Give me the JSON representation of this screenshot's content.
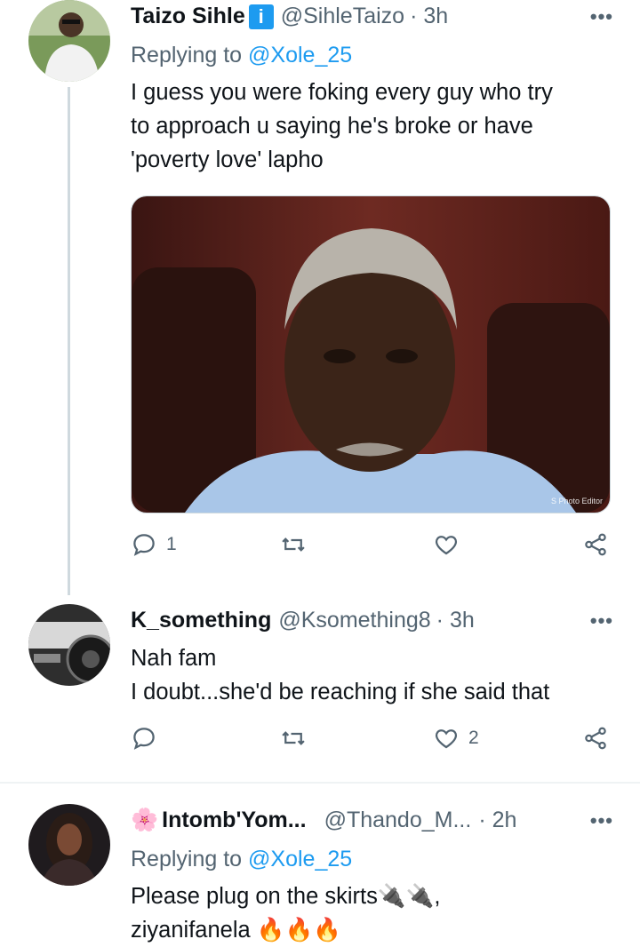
{
  "tweets": [
    {
      "name": "Taizo Sihle",
      "verified_badge": "i",
      "handle": "@SihleTaizo",
      "time": "· 3h",
      "replying_label": "Replying to",
      "replying_handle": "@Xole_25",
      "text": "I  guess you  were foking every guy who try\nto approach u saying he's broke or have\n'poverty love' lapho",
      "media_watermark": "S Photo Editor",
      "reply_count": "1",
      "retweet_count": "",
      "like_count": ""
    },
    {
      "name": "K_something",
      "handle": "@Ksomething8",
      "time": "· 3h",
      "text": "Nah fam\nI doubt...she'd be reaching if she said that",
      "reply_count": "",
      "retweet_count": "",
      "like_count": "2"
    },
    {
      "name_prefix_emoji": "🌸",
      "name": "Intomb'Yom...",
      "handle": "@Thando_M...",
      "time": "· 2h",
      "replying_label": "Replying to",
      "replying_handle": "@Xole_25",
      "text_line1": "Please plug on the skirts",
      "text_line1_suffix": ",",
      "text_line2": "ziyanifanela",
      "emoji_plug": "🔌",
      "emoji_fire": "🔥"
    }
  ],
  "colors": {
    "link": "#1d9bf0",
    "muted": "#536471",
    "text": "#0f1419",
    "divider": "#eff3f4",
    "thread_line": "#cfd9de"
  },
  "icons": [
    "reply-icon",
    "retweet-icon",
    "like-icon",
    "share-icon",
    "more-icon"
  ]
}
